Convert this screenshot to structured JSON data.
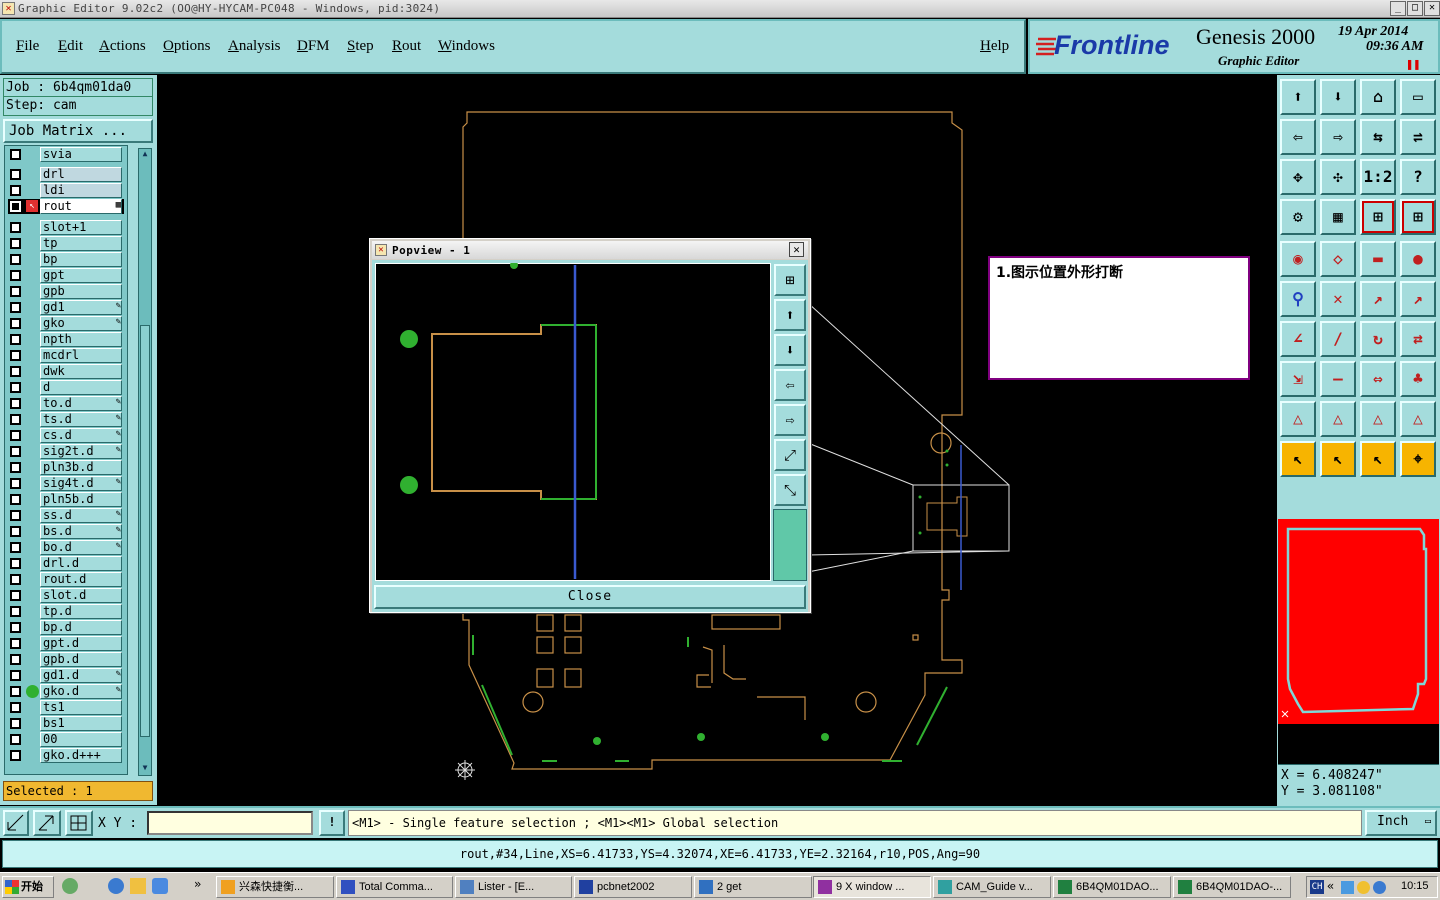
{
  "window": {
    "title": "Graphic Editor 9.02c2 (OO@HY-HYCAM-PC048 - Windows, pid:3024)"
  },
  "menu": {
    "items": [
      "File",
      "Edit",
      "Actions",
      "Options",
      "Analysis",
      "DFM",
      "Step",
      "Rout",
      "Windows"
    ],
    "help": "Help"
  },
  "logo": {
    "brand": "Frontline",
    "product": "Genesis 2000",
    "subtitle": "Graphic Editor",
    "date": "19 Apr 2014",
    "time": "09:36 AM"
  },
  "job": {
    "job_label": "Job : 6b4qm01da0",
    "step_label": "Step: cam",
    "matrix_button": "Job Matrix ..."
  },
  "layers": [
    "svia",
    "drl",
    "ldi",
    "rout",
    "slot+1",
    "tp",
    "bp",
    "gpt",
    "gpb",
    "gd1",
    "gko",
    "npth",
    "mcdrl",
    "dwk",
    "d",
    "to.d",
    "ts.d",
    "cs.d",
    "sig2t.d",
    "pln3b.d",
    "sig4t.d",
    "pln5b.d",
    "ss.d",
    "bs.d",
    "bo.d",
    "drl.d",
    "rout.d",
    "slot.d",
    "tp.d",
    "bp.d",
    "gpt.d",
    "gpb.d",
    "gd1.d",
    "gko.d",
    "ts1",
    "bs1",
    "00",
    "gko.d+++"
  ],
  "selected": "Selected : 1",
  "popup": {
    "title": "Popview - 1",
    "close_label": "Close"
  },
  "note": {
    "text": "1.图示位置外形打断"
  },
  "coords": {
    "x": "X = 6.408247\"",
    "y": "Y = 3.081108\""
  },
  "status": {
    "xy_label": "X Y :",
    "xy_value": "",
    "hint": "<M1> - Single feature selection ; <M1><M1> Global selection",
    "units": "Inch"
  },
  "feature_info": "rout,#34,Line,XS=6.41733,YS=4.32074,XE=6.41733,YE=2.32164,r10,POS,Ang=90",
  "taskbar": {
    "start": "开始",
    "tasks": [
      "兴森快捷衡...",
      "Total Comma...",
      "Lister - [E...",
      "pcbnet2002",
      "2 get",
      "9 X window ...",
      "CAM_Guide v...",
      "6B4QM01DAO...",
      "6B4QM01DAO-..."
    ],
    "clock": "10:15"
  },
  "colors": {
    "panel": "#a4dcdc",
    "board_outline": "#c89048",
    "green": "#30b030",
    "selection": "#f7b400",
    "preview": "#ff0000"
  }
}
